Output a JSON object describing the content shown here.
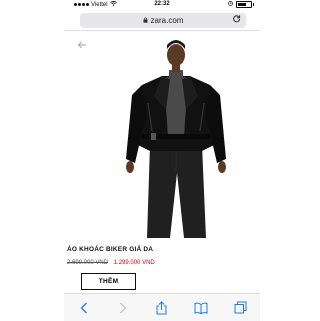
{
  "status": {
    "carrier": "Viettel",
    "time": "22:32",
    "battery_level_percent": 70
  },
  "browser": {
    "url": "zara.com",
    "lock_icon": "lock-icon",
    "reload_icon": "reload-icon"
  },
  "product": {
    "title": "ÁO KHOÁC BIKER GIẢ DA",
    "old_price": "2.699.000 VND",
    "new_price": "1.299.000 VND",
    "add_button": "THÊM"
  },
  "toolbar": {
    "items": [
      "back-icon",
      "forward-icon",
      "share-icon",
      "bookmarks-icon",
      "tabs-icon"
    ]
  },
  "colors": {
    "accent": "#1b7cf0",
    "sale_price": "#d0021b"
  }
}
